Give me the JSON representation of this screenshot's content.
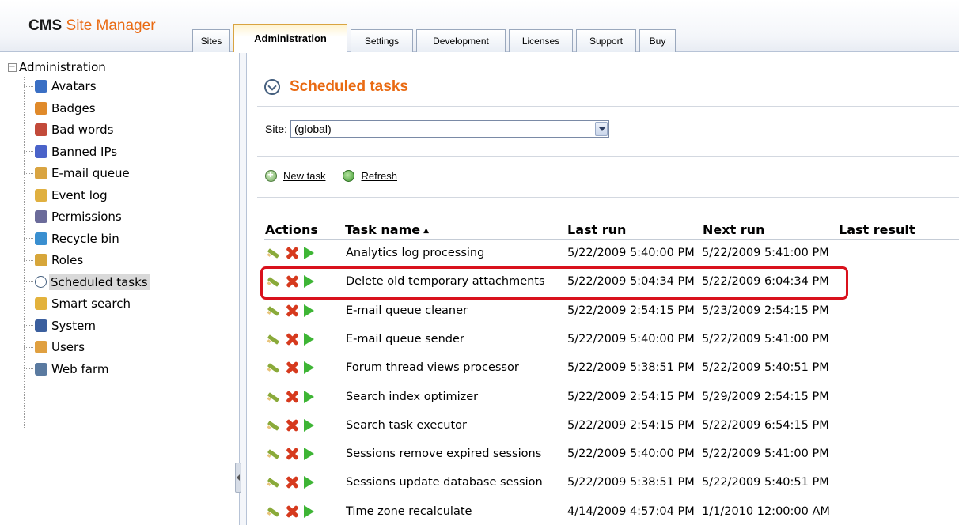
{
  "app": {
    "brand_bold": "CMS",
    "brand_rest": "Site Manager"
  },
  "tabs": [
    {
      "label": "Sites",
      "active": false
    },
    {
      "label": "Administration",
      "active": true
    },
    {
      "label": "Settings",
      "active": false
    },
    {
      "label": "Development",
      "active": false
    },
    {
      "label": "Licenses",
      "active": false
    },
    {
      "label": "Support",
      "active": false
    },
    {
      "label": "Buy",
      "active": false
    }
  ],
  "sidebar": {
    "root_label": "Administration",
    "items": [
      {
        "label": "Avatars",
        "icon": "avatars-icon"
      },
      {
        "label": "Badges",
        "icon": "badges-icon"
      },
      {
        "label": "Bad words",
        "icon": "bad-words-icon"
      },
      {
        "label": "Banned IPs",
        "icon": "banned-ips-icon"
      },
      {
        "label": "E-mail queue",
        "icon": "email-queue-icon"
      },
      {
        "label": "Event log",
        "icon": "event-log-icon"
      },
      {
        "label": "Permissions",
        "icon": "permissions-icon"
      },
      {
        "label": "Recycle bin",
        "icon": "recycle-bin-icon"
      },
      {
        "label": "Roles",
        "icon": "roles-icon"
      },
      {
        "label": "Scheduled tasks",
        "icon": "scheduled-tasks-icon",
        "selected": true
      },
      {
        "label": "Smart search",
        "icon": "smart-search-icon"
      },
      {
        "label": "System",
        "icon": "system-icon"
      },
      {
        "label": "Users",
        "icon": "users-icon"
      },
      {
        "label": "Web farm",
        "icon": "web-farm-icon"
      }
    ]
  },
  "main": {
    "title": "Scheduled tasks",
    "site_label": "Site:",
    "site_value": "(global)",
    "new_task": "New task",
    "refresh": "Refresh"
  },
  "grid": {
    "headers": {
      "actions": "Actions",
      "task_name": "Task name",
      "sort_indicator": "▲",
      "last_run": "Last run",
      "next_run": "Next run",
      "last_result": "Last result"
    },
    "rows": [
      {
        "task": "Analytics log processing",
        "last_run": "5/22/2009 5:40:00 PM",
        "next_run": "5/22/2009 5:41:00 PM"
      },
      {
        "task": "Delete old temporary attachments",
        "last_run": "5/22/2009 5:04:34 PM",
        "next_run": "5/22/2009 6:04:34 PM",
        "highlighted": true
      },
      {
        "task": "E-mail queue cleaner",
        "last_run": "5/22/2009 2:54:15 PM",
        "next_run": "5/23/2009 2:54:15 PM"
      },
      {
        "task": "E-mail queue sender",
        "last_run": "5/22/2009 5:40:00 PM",
        "next_run": "5/22/2009 5:41:00 PM"
      },
      {
        "task": "Forum thread views processor",
        "last_run": "5/22/2009 5:38:51 PM",
        "next_run": "5/22/2009 5:40:51 PM"
      },
      {
        "task": "Search index optimizer",
        "last_run": "5/22/2009 2:54:15 PM",
        "next_run": "5/29/2009 2:54:15 PM"
      },
      {
        "task": "Search task executor",
        "last_run": "5/22/2009 2:54:15 PM",
        "next_run": "5/22/2009 6:54:15 PM"
      },
      {
        "task": "Sessions remove expired sessions",
        "last_run": "5/22/2009 5:40:00 PM",
        "next_run": "5/22/2009 5:41:00 PM"
      },
      {
        "task": "Sessions update database session",
        "last_run": "5/22/2009 5:38:51 PM",
        "next_run": "5/22/2009 5:40:51 PM"
      },
      {
        "task": "Time zone recalculate",
        "last_run": "4/14/2009 4:57:04 PM",
        "next_run": "1/1/2010 12:00:00 AM"
      }
    ]
  },
  "colors": {
    "brand_orange": "#e96a12",
    "highlight_red": "#d9111c",
    "run_green": "#3eb535",
    "delete_red": "#d63a1e"
  }
}
